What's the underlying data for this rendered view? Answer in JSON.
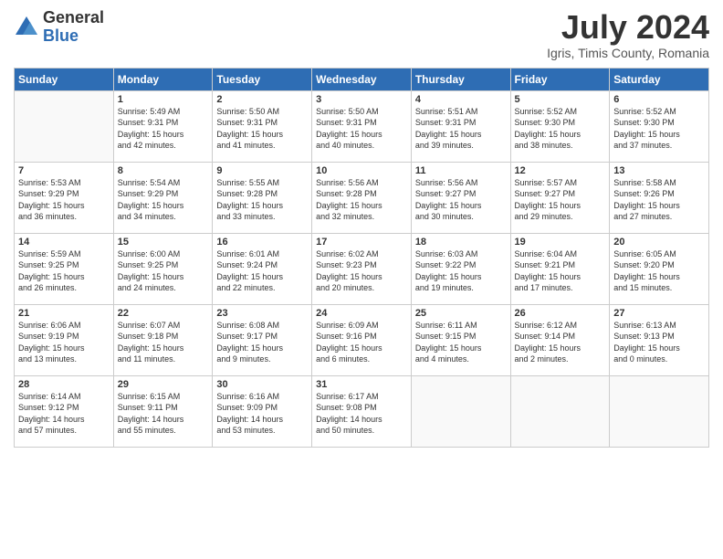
{
  "logo": {
    "general": "General",
    "blue": "Blue"
  },
  "title": "July 2024",
  "location": "Igris, Timis County, Romania",
  "headers": [
    "Sunday",
    "Monday",
    "Tuesday",
    "Wednesday",
    "Thursday",
    "Friday",
    "Saturday"
  ],
  "weeks": [
    [
      {
        "day": "",
        "info": ""
      },
      {
        "day": "1",
        "info": "Sunrise: 5:49 AM\nSunset: 9:31 PM\nDaylight: 15 hours\nand 42 minutes."
      },
      {
        "day": "2",
        "info": "Sunrise: 5:50 AM\nSunset: 9:31 PM\nDaylight: 15 hours\nand 41 minutes."
      },
      {
        "day": "3",
        "info": "Sunrise: 5:50 AM\nSunset: 9:31 PM\nDaylight: 15 hours\nand 40 minutes."
      },
      {
        "day": "4",
        "info": "Sunrise: 5:51 AM\nSunset: 9:31 PM\nDaylight: 15 hours\nand 39 minutes."
      },
      {
        "day": "5",
        "info": "Sunrise: 5:52 AM\nSunset: 9:30 PM\nDaylight: 15 hours\nand 38 minutes."
      },
      {
        "day": "6",
        "info": "Sunrise: 5:52 AM\nSunset: 9:30 PM\nDaylight: 15 hours\nand 37 minutes."
      }
    ],
    [
      {
        "day": "7",
        "info": "Sunrise: 5:53 AM\nSunset: 9:29 PM\nDaylight: 15 hours\nand 36 minutes."
      },
      {
        "day": "8",
        "info": "Sunrise: 5:54 AM\nSunset: 9:29 PM\nDaylight: 15 hours\nand 34 minutes."
      },
      {
        "day": "9",
        "info": "Sunrise: 5:55 AM\nSunset: 9:28 PM\nDaylight: 15 hours\nand 33 minutes."
      },
      {
        "day": "10",
        "info": "Sunrise: 5:56 AM\nSunset: 9:28 PM\nDaylight: 15 hours\nand 32 minutes."
      },
      {
        "day": "11",
        "info": "Sunrise: 5:56 AM\nSunset: 9:27 PM\nDaylight: 15 hours\nand 30 minutes."
      },
      {
        "day": "12",
        "info": "Sunrise: 5:57 AM\nSunset: 9:27 PM\nDaylight: 15 hours\nand 29 minutes."
      },
      {
        "day": "13",
        "info": "Sunrise: 5:58 AM\nSunset: 9:26 PM\nDaylight: 15 hours\nand 27 minutes."
      }
    ],
    [
      {
        "day": "14",
        "info": "Sunrise: 5:59 AM\nSunset: 9:25 PM\nDaylight: 15 hours\nand 26 minutes."
      },
      {
        "day": "15",
        "info": "Sunrise: 6:00 AM\nSunset: 9:25 PM\nDaylight: 15 hours\nand 24 minutes."
      },
      {
        "day": "16",
        "info": "Sunrise: 6:01 AM\nSunset: 9:24 PM\nDaylight: 15 hours\nand 22 minutes."
      },
      {
        "day": "17",
        "info": "Sunrise: 6:02 AM\nSunset: 9:23 PM\nDaylight: 15 hours\nand 20 minutes."
      },
      {
        "day": "18",
        "info": "Sunrise: 6:03 AM\nSunset: 9:22 PM\nDaylight: 15 hours\nand 19 minutes."
      },
      {
        "day": "19",
        "info": "Sunrise: 6:04 AM\nSunset: 9:21 PM\nDaylight: 15 hours\nand 17 minutes."
      },
      {
        "day": "20",
        "info": "Sunrise: 6:05 AM\nSunset: 9:20 PM\nDaylight: 15 hours\nand 15 minutes."
      }
    ],
    [
      {
        "day": "21",
        "info": "Sunrise: 6:06 AM\nSunset: 9:19 PM\nDaylight: 15 hours\nand 13 minutes."
      },
      {
        "day": "22",
        "info": "Sunrise: 6:07 AM\nSunset: 9:18 PM\nDaylight: 15 hours\nand 11 minutes."
      },
      {
        "day": "23",
        "info": "Sunrise: 6:08 AM\nSunset: 9:17 PM\nDaylight: 15 hours\nand 9 minutes."
      },
      {
        "day": "24",
        "info": "Sunrise: 6:09 AM\nSunset: 9:16 PM\nDaylight: 15 hours\nand 6 minutes."
      },
      {
        "day": "25",
        "info": "Sunrise: 6:11 AM\nSunset: 9:15 PM\nDaylight: 15 hours\nand 4 minutes."
      },
      {
        "day": "26",
        "info": "Sunrise: 6:12 AM\nSunset: 9:14 PM\nDaylight: 15 hours\nand 2 minutes."
      },
      {
        "day": "27",
        "info": "Sunrise: 6:13 AM\nSunset: 9:13 PM\nDaylight: 15 hours\nand 0 minutes."
      }
    ],
    [
      {
        "day": "28",
        "info": "Sunrise: 6:14 AM\nSunset: 9:12 PM\nDaylight: 14 hours\nand 57 minutes."
      },
      {
        "day": "29",
        "info": "Sunrise: 6:15 AM\nSunset: 9:11 PM\nDaylight: 14 hours\nand 55 minutes."
      },
      {
        "day": "30",
        "info": "Sunrise: 6:16 AM\nSunset: 9:09 PM\nDaylight: 14 hours\nand 53 minutes."
      },
      {
        "day": "31",
        "info": "Sunrise: 6:17 AM\nSunset: 9:08 PM\nDaylight: 14 hours\nand 50 minutes."
      },
      {
        "day": "",
        "info": ""
      },
      {
        "day": "",
        "info": ""
      },
      {
        "day": "",
        "info": ""
      }
    ]
  ]
}
